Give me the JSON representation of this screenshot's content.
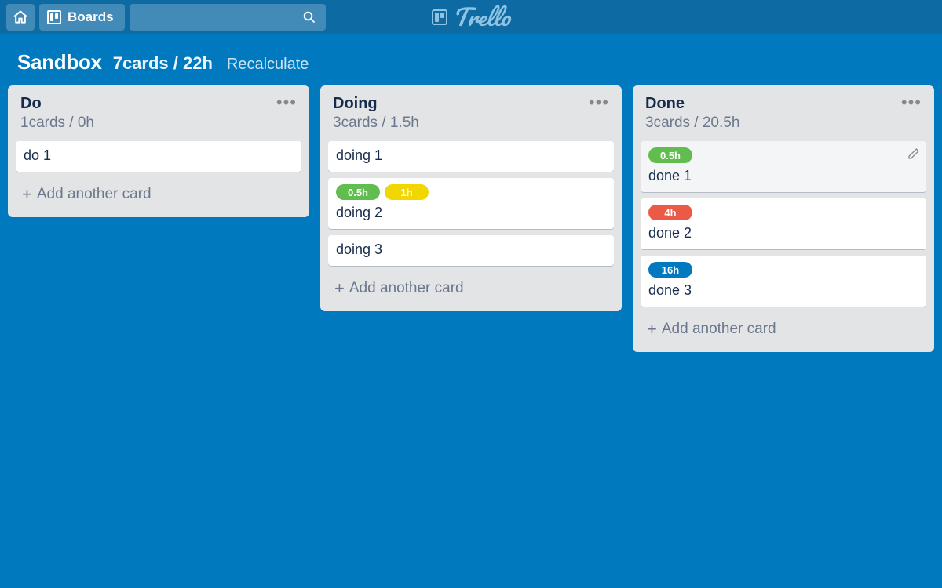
{
  "app": {
    "logo_text": "Trello",
    "boards_label": "Boards"
  },
  "board": {
    "title": "Sandbox",
    "summary": "7cards / 22h",
    "recalculate_label": "Recalculate",
    "add_card_label": "Add another card"
  },
  "lists": [
    {
      "title": "Do",
      "summary": "1cards / 0h",
      "cards": [
        {
          "title": "do 1",
          "labels": [],
          "hover": false
        }
      ]
    },
    {
      "title": "Doing",
      "summary": "3cards / 1.5h",
      "cards": [
        {
          "title": "doing 1",
          "labels": [],
          "hover": false
        },
        {
          "title": "doing 2",
          "labels": [
            {
              "text": "0.5h",
              "color": "green"
            },
            {
              "text": "1h",
              "color": "yellow"
            }
          ],
          "hover": false
        },
        {
          "title": "doing 3",
          "labels": [],
          "hover": false
        }
      ]
    },
    {
      "title": "Done",
      "summary": "3cards / 20.5h",
      "cards": [
        {
          "title": "done 1",
          "labels": [
            {
              "text": "0.5h",
              "color": "green"
            }
          ],
          "hover": true
        },
        {
          "title": "done 2",
          "labels": [
            {
              "text": "4h",
              "color": "red"
            }
          ],
          "hover": false
        },
        {
          "title": "done 3",
          "labels": [
            {
              "text": "16h",
              "color": "blue"
            }
          ],
          "hover": false
        }
      ]
    }
  ],
  "colors": {
    "green": "#61bd4f",
    "yellow": "#f2d600",
    "red": "#eb5a46",
    "blue": "#0079bf"
  }
}
